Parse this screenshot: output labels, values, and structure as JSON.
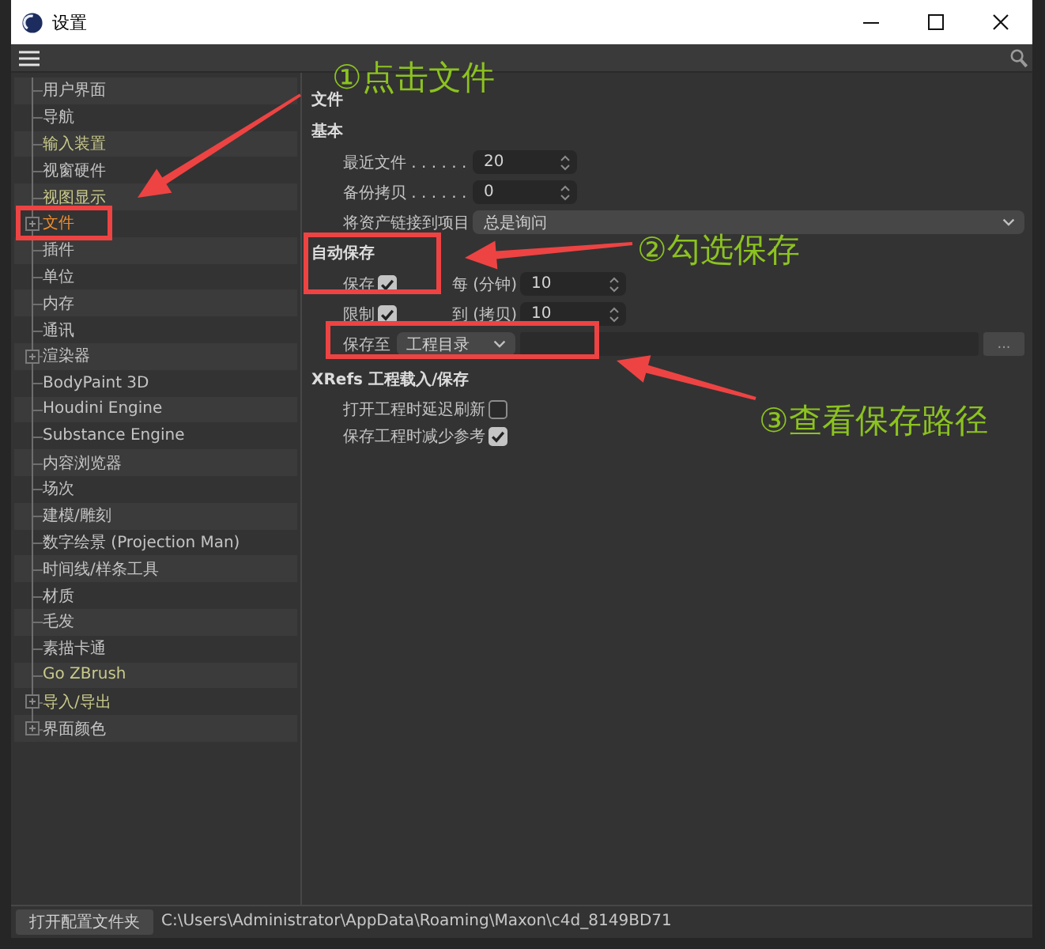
{
  "window": {
    "title": "设置"
  },
  "sidebar": {
    "items": [
      {
        "label": "用户界面",
        "selected": false,
        "expandable": false,
        "color": "#c4c4c4"
      },
      {
        "label": "导航",
        "selected": false,
        "expandable": false,
        "color": "#c4c4c4"
      },
      {
        "label": "输入装置",
        "selected": false,
        "expandable": false,
        "color": "#c9c98b"
      },
      {
        "label": "视窗硬件",
        "selected": false,
        "expandable": false,
        "color": "#c4c4c4"
      },
      {
        "label": "视图显示",
        "selected": false,
        "expandable": false,
        "color": "#c9c98b"
      },
      {
        "label": "文件",
        "selected": true,
        "expandable": true
      },
      {
        "label": "插件",
        "selected": false,
        "expandable": false,
        "color": "#c4c4c4"
      },
      {
        "label": "单位",
        "selected": false,
        "expandable": false,
        "color": "#c4c4c4"
      },
      {
        "label": "内存",
        "selected": false,
        "expandable": false,
        "color": "#c4c4c4"
      },
      {
        "label": "通讯",
        "selected": false,
        "expandable": false,
        "color": "#c4c4c4"
      },
      {
        "label": "渲染器",
        "selected": false,
        "expandable": true,
        "color": "#c4c4c4"
      },
      {
        "label": "BodyPaint 3D",
        "selected": false,
        "expandable": false,
        "color": "#c4c4c4"
      },
      {
        "label": "Houdini Engine",
        "selected": false,
        "expandable": false,
        "color": "#c4c4c4"
      },
      {
        "label": "Substance Engine",
        "selected": false,
        "expandable": false,
        "color": "#c4c4c4"
      },
      {
        "label": "内容浏览器",
        "selected": false,
        "expandable": false,
        "color": "#c4c4c4"
      },
      {
        "label": "场次",
        "selected": false,
        "expandable": false,
        "color": "#c4c4c4"
      },
      {
        "label": "建模/雕刻",
        "selected": false,
        "expandable": false,
        "color": "#c4c4c4"
      },
      {
        "label": "数字绘景 (Projection Man)",
        "selected": false,
        "expandable": false,
        "color": "#c4c4c4"
      },
      {
        "label": "时间线/样条工具",
        "selected": false,
        "expandable": false,
        "color": "#c4c4c4"
      },
      {
        "label": "材质",
        "selected": false,
        "expandable": false,
        "color": "#c4c4c4"
      },
      {
        "label": "毛发",
        "selected": false,
        "expandable": false,
        "color": "#c4c4c4"
      },
      {
        "label": "素描卡通",
        "selected": false,
        "expandable": false,
        "color": "#c4c4c4"
      },
      {
        "label": "Go ZBrush",
        "selected": false,
        "expandable": false,
        "color": "#c9c98b"
      },
      {
        "label": "导入/导出",
        "selected": false,
        "expandable": true,
        "color": "#c9c98b"
      },
      {
        "label": "界面颜色",
        "selected": false,
        "expandable": true,
        "color": "#c4c4c4"
      }
    ]
  },
  "content": {
    "title": "文件",
    "sections": [
      {
        "heading": "基本",
        "rows": [
          {
            "kind": "number",
            "label": "最近文件 . . . . . .",
            "value": "20"
          },
          {
            "kind": "number",
            "label": "备份拷贝 . . . . . .",
            "value": "0"
          },
          {
            "kind": "dropdown",
            "label": "将资产链接到项目",
            "value": "总是询问"
          }
        ]
      },
      {
        "heading": "自动保存",
        "rows": [
          {
            "kind": "check-number",
            "label": "保存",
            "checked": true,
            "sublabel": "每 (分钟)",
            "value": "10"
          },
          {
            "kind": "check-number",
            "label": "限制",
            "checked": true,
            "sublabel": "到 (拷贝)",
            "value": "10"
          },
          {
            "kind": "path",
            "label": "保存至",
            "value": "工程目录",
            "button": "..."
          }
        ]
      },
      {
        "heading": "XRefs 工程载入/保存",
        "rows": [
          {
            "kind": "checkbox",
            "label": "打开工程时延迟刷新",
            "checked": false
          },
          {
            "kind": "checkbox",
            "label": "保存工程时减少参考",
            "checked": true
          }
        ]
      }
    ]
  },
  "footer": {
    "button": "打开配置文件夹",
    "path": "C:\\Users\\Administrator\\AppData\\Roaming\\Maxon\\c4d_8149BD71"
  },
  "annotations": [
    {
      "text": "①点击文件"
    },
    {
      "text": "②勾选保存"
    },
    {
      "text": "③查看保存路径"
    }
  ]
}
